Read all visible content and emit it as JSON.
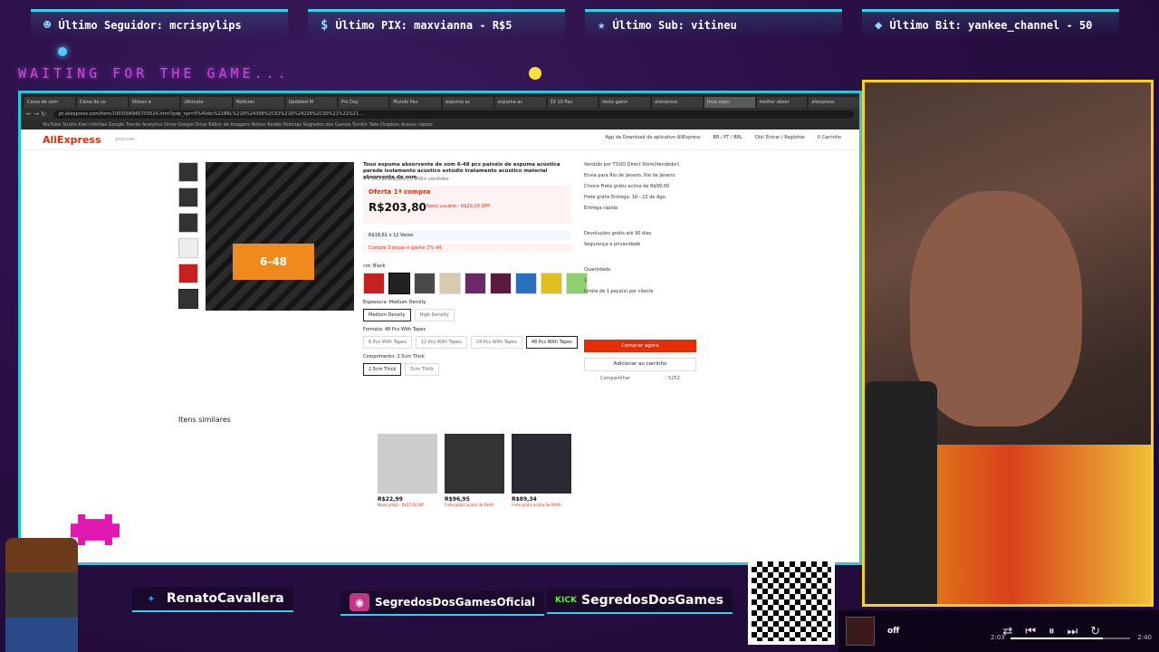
{
  "overlay": {
    "alerts": [
      {
        "icon": "person-icon",
        "label": "Último Seguidor: mcrispylips"
      },
      {
        "icon": "dollar-icon",
        "label": "Último PIX: maxvianna - R$5"
      },
      {
        "icon": "star-icon",
        "label": "Último Sub: vitineu"
      },
      {
        "icon": "diamond-icon",
        "label": "Último Bit: yankee_channel - 50"
      }
    ],
    "waiting_text": "WAITING FOR THE GAME...",
    "socials": [
      {
        "icon": "twitter-icon",
        "label": "RenatoCavallera",
        "color": "#1da1f2"
      },
      {
        "icon": "instagram-icon",
        "label": "SegredosDosGamesOficial",
        "color": "#c13584"
      },
      {
        "icon": "kick-icon",
        "label": "SegredosDosGames",
        "color": "#53fc18"
      }
    ],
    "qr_url": "livepix.gg/segredosdosgames",
    "player": {
      "status": "off",
      "elapsed": "2:03",
      "duration": "2:40",
      "progress": 0.77
    }
  },
  "browser": {
    "tabs": [
      "Caixa de som",
      "Caixa de so",
      "Vídeos e",
      "Ultimate",
      "Notícias",
      "Updated M",
      "Pro Day",
      "Mundo Pax",
      "espuma ac",
      "espuma ac",
      "33 10 Pax",
      "testa galon",
      "aliexpress",
      "touo espu",
      "melhor absor",
      "aliexpress"
    ],
    "url": "pt.aliexpress.com/item/1005006960703524.html?pdp_npi=5%40dis%21BRL%21R%24308%2C63%21R%24226%2C00%21%21%21...",
    "bookmarks": "YouTube Studio   Kiwi   Infinitas   Google Trends   Analytics   Drive   Google Drive   Editor de Imagens   Notion   Reddit   Notícias   Segredos dos Games   Tumblr   Tabs   Dropbox   Acesso rápido"
  },
  "ali": {
    "logo": "AliExpress",
    "search_placeholder": "procurar",
    "header_right": [
      "App de Download do aplicativo AliExpress",
      "BR / PT / BRL",
      "Olá! Entrar / Registrar",
      "0 Carrinho"
    ],
    "title": "Touo espuma absorvente de som 6-48 pcs painéis de espuma acústica parede isolamento acústico estúdio tratamento acústico material absorvente de som",
    "rating": "4.4  343 avaliações  |  2.000+ vendidos",
    "promo_label": "Oferta 1ª compra",
    "price": "R$203,80",
    "promo_note": "Novo usuário - R$29,00 OFF",
    "coupon1": "R$18,61 x 12 Vezes",
    "coupon2": "Compre 3 peças e ganhe 2% off",
    "color_label": "cor: Black",
    "swatch_colors": [
      "#c62020",
      "#222222",
      "#4a4a4a",
      "#d9c9b0",
      "#6a2a6a",
      "#5a1a40",
      "#2a70c0",
      "#e0c020",
      "#90d070"
    ],
    "thickness_label": "Espessura: Medium Density",
    "thickness_opts": [
      "Medium Density",
      "High Density"
    ],
    "format_label": "Formato: 48 Pcs With Tapes",
    "format_opts": [
      "6 Pcs With Tapes",
      "12 Pcs With Tapes",
      "24 Pcs With Tapes",
      "48 Pcs With Tapes"
    ],
    "length_label": "Comprimento: 2.5cm Thick",
    "length_opts": [
      "2.5cm Thick",
      "5cm Thick"
    ],
    "side": {
      "sold_by": "Vendido por   TOUO Direct Store(Vendedor)",
      "ship_to": "Envia para   Rio de Janeiro, Rio de Janeiro",
      "choice": "Choice  Frete grátis acima de R$99,00",
      "free_ship": "Frete grátis  Entrega: 16 - 22 de Ago.",
      "fast": "Entrega rápida",
      "returns": "Devoluções grátis até 90 dias",
      "security": "Segurança e privacidade",
      "qty_label": "Quantidade",
      "qty": "1",
      "limit": "Limite de 1 peça(s) por cliente",
      "buy": "Comprar agora",
      "cart": "Adicionar ao carrinho",
      "share": "Compartilhar",
      "likes": "5252"
    },
    "similar_title": "Itens similares",
    "similar": [
      {
        "price": "R$22,99",
        "meta": "Novo preço - R$57,00 Off"
      },
      {
        "price": "R$96,95",
        "meta": "Frete grátis acima de R$99"
      },
      {
        "price": "R$89,34",
        "meta": "Frete grátis acima de R$99"
      }
    ]
  }
}
